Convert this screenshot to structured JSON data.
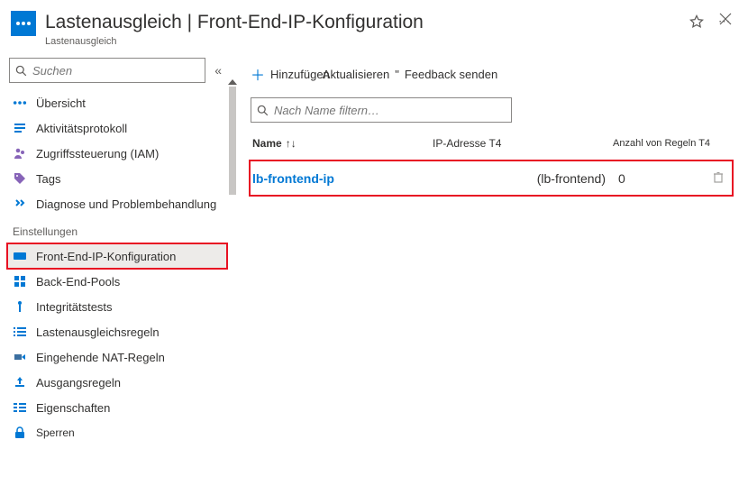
{
  "header": {
    "title": "Lastenausgleich |   Front-End-IP-Konfiguration",
    "subtitle": "Lastenausgleich"
  },
  "sidebar": {
    "search_placeholder": "Suchen",
    "section_settings": "Einstellungen",
    "items": {
      "overview": "Übersicht",
      "activity": "Aktivitätsprotokoll",
      "access": "Zugriffssteuerung (IAM)",
      "tags": "Tags",
      "diag": "Diagnose und Problembehandlung",
      "frontend": "Front-End-IP-Konfiguration",
      "backend": "Back-End-Pools",
      "health": "Integritätstests",
      "rules": "Lastenausgleichsregeln",
      "nat": "Eingehende NAT-Regeln",
      "outbound": "Ausgangsregeln",
      "props": "Eigenschaften",
      "locks": "Sperren"
    }
  },
  "toolbar": {
    "add": "Hinzufügen",
    "refresh": "Aktualisieren",
    "feedback": "Feedback senden"
  },
  "filter_placeholder": "Nach Name filtern…",
  "columns": {
    "name": "Name",
    "ip": "IP-Adresse T4",
    "rules": "Anzahl von Regeln T4"
  },
  "rows": [
    {
      "name": "lb-frontend-ip",
      "ip": "(lb-frontend)",
      "rules": "0"
    }
  ]
}
